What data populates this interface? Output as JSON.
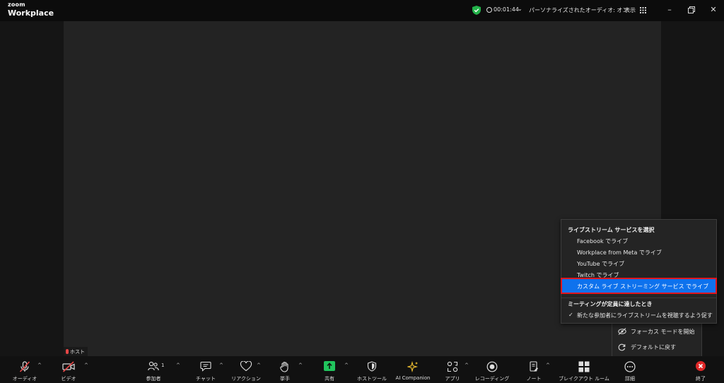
{
  "titlebar": {
    "logo_top": "zoom",
    "logo_bottom": "Workplace",
    "timer": "00:01:44",
    "audio_status": "パーソナライズされたオーディオ: オン",
    "view_label": "表示"
  },
  "host_tag": "ホスト",
  "livestream_menu": {
    "heading": "ライブストリーム サービスを選択",
    "options": [
      "Facebook でライブ",
      "Workplace from Meta でライブ",
      "YouTube でライブ",
      "Twitch でライブ"
    ],
    "highlighted": "カスタム ライブ ストリーミング サービス でライブ",
    "section2_heading": "ミーティングが定員に達したとき",
    "checked_option": "新たな参加者にライブストリームを視聴するよう促す"
  },
  "more_menu": {
    "focus_mode": "フォーカス モードを開始",
    "reset_default": "デフォルトに戻す"
  },
  "toolbar": {
    "audio": "オーディオ",
    "video": "ビデオ",
    "participants": "参加者",
    "participants_count": "1",
    "chat": "チャット",
    "reactions": "リアクション",
    "raise_hand": "挙手",
    "share": "共有",
    "host_tools": "ホストツール",
    "ai_companion": "AI Companion",
    "apps": "アプリ",
    "recording": "レコーディング",
    "notes": "ノート",
    "breakout": "ブレイクアウト ルーム",
    "more": "詳細",
    "end": "終了"
  },
  "colors": {
    "accent_blue": "#0e72ed",
    "highlight_border": "#e0161e",
    "share_green": "#21c55d",
    "end_red": "#e02828",
    "shield_green": "#23b34a"
  }
}
